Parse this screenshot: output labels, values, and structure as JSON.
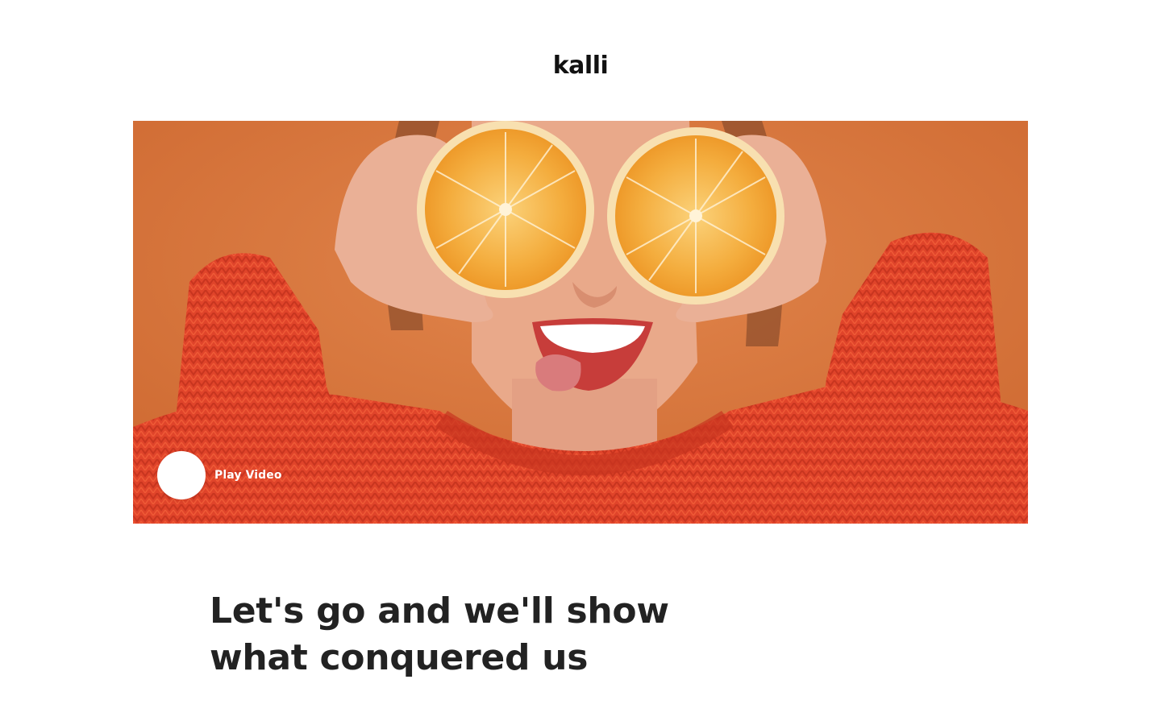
{
  "header": {
    "logo": "kalli"
  },
  "hero": {
    "image_alt": "Woman in orange sweater holding orange halves over her eyes",
    "play_label": "Play Video",
    "background_color": "#d9783e",
    "sweater_color": "#e2452a"
  },
  "main": {
    "headline_line1": "Let's go and we'll show",
    "headline_line2": "what conquered us"
  }
}
